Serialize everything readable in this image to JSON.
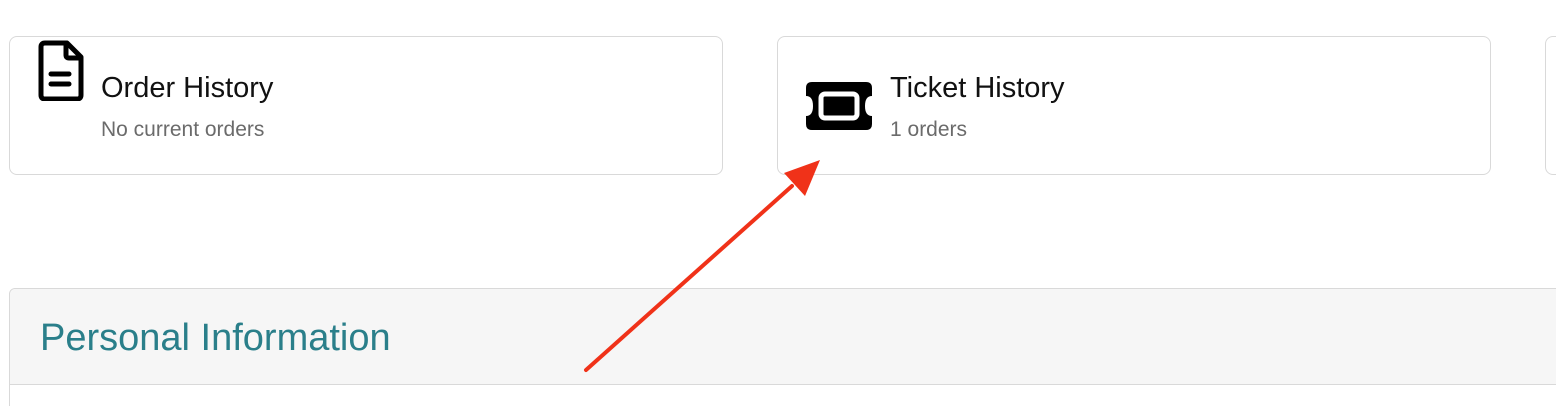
{
  "cards": [
    {
      "title": "Order History",
      "subtitle": "No current orders",
      "icon": "document-icon"
    },
    {
      "title": "Ticket History",
      "subtitle": "1 orders",
      "icon": "ticket-icon"
    }
  ],
  "section": {
    "title": "Personal Information"
  },
  "colors": {
    "accent_text": "#2a7f8a",
    "annotation_arrow": "#f03219",
    "card_border": "#d9d9d9",
    "section_header_bg": "#f6f6f6"
  }
}
